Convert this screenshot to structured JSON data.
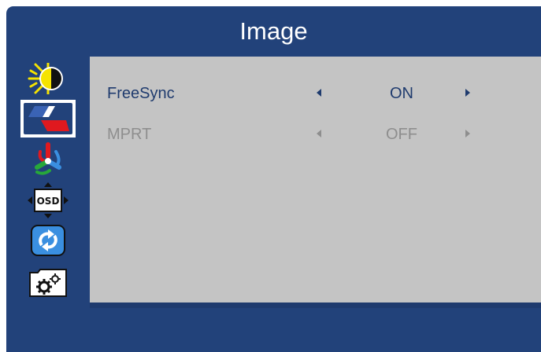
{
  "title": "Image",
  "colors": {
    "panel": "#22427a",
    "content": "#c4c4c4",
    "active_text": "#1f3b6e",
    "disabled_text": "#8e8e8e",
    "selected_tab_bg": "#ffffff"
  },
  "sidebar": {
    "items": [
      {
        "icon": "brightness-contrast-icon",
        "selected": false
      },
      {
        "icon": "image-icon",
        "selected": true
      },
      {
        "icon": "color-icon",
        "selected": false
      },
      {
        "icon": "osd-icon",
        "selected": false
      },
      {
        "icon": "reset-icon",
        "selected": false
      },
      {
        "icon": "settings-icon",
        "selected": false
      }
    ],
    "osd_icon_text": "OSD"
  },
  "settings": [
    {
      "label": "FreeSync",
      "value": "ON",
      "state": "active"
    },
    {
      "label": "MPRT",
      "value": "OFF",
      "state": "disabled"
    }
  ]
}
